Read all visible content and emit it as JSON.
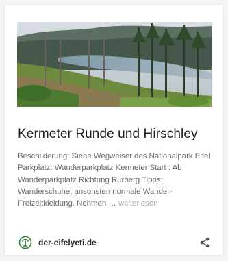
{
  "card": {
    "image_alt": "Kermeter Runde landscape",
    "title": "Kermeter Runde und Hirschley",
    "excerpt": "Beschilderung: Siehe Wegweiser des Nationalpark Eifel Parkplatz: Wanderparkplatz Kermeter Start : Ab Wanderparkplatz Richtung Rurberg Tipps: Wanderschuhe, ansonsten normale Wander-Freizeitkleidung. Nehmen … ",
    "read_more": "weiterlesen",
    "source": {
      "site": "der-eifelyeti.de",
      "logo_icon": "eifelyeti-logo-icon"
    },
    "share_icon": "share-icon"
  },
  "colors": {
    "title": "#1d1d1d",
    "excerpt": "#6b6b6b",
    "read_more": "#a8a8a8",
    "logo_green": "#2e7d32"
  }
}
